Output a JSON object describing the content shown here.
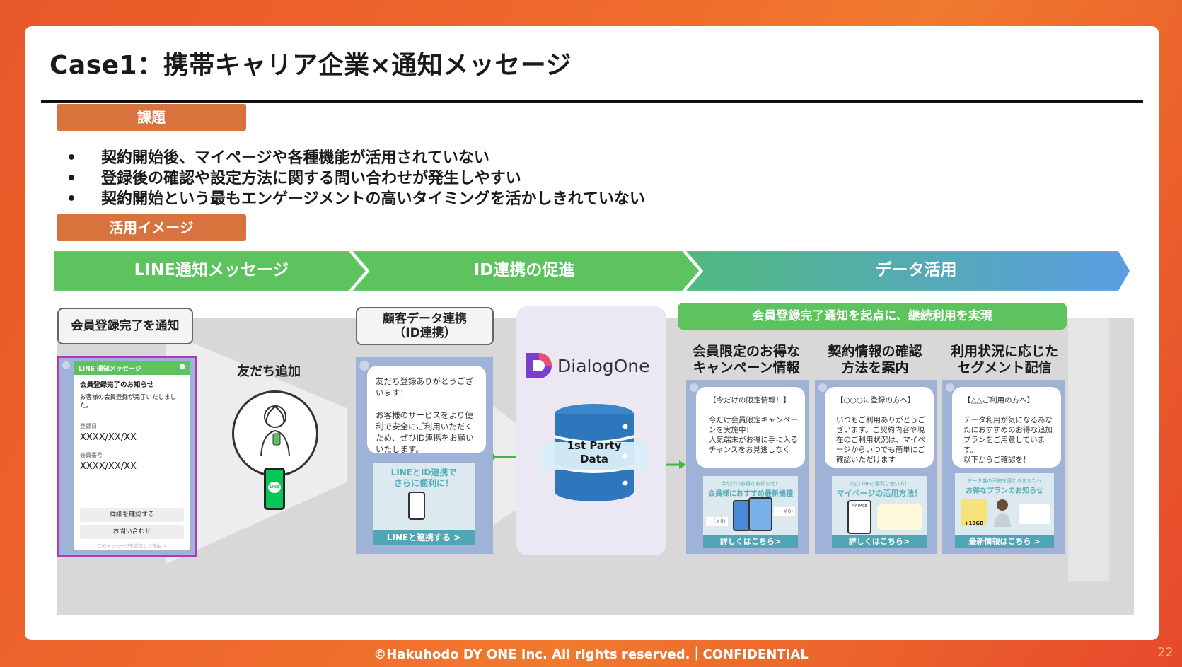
{
  "title": "Case1：携帯キャリア企業×通知メッセージ",
  "issue_label": "課題",
  "issues": [
    "契約開始後、マイページや各種機能が活用されていない",
    "登録後の確認や設定方法に関する問い合わせが発生しやすい",
    "契約開始という最もエンゲージメントの高いタイミングを活かしきれていない"
  ],
  "usage_label": "活用イメージ",
  "steps": [
    "LINE通知メッセージ",
    "ID連携の促進",
    "データ活用"
  ],
  "step1": {
    "box": "会員登録完了を通知",
    "header": "LINE 通知メッセージ",
    "msg_title": "会員登録完了のお知らせ",
    "msg_body": "お客様の会員登録が完了いたしました。",
    "field1_label": "登録日",
    "field1_value": "XXXX/XX/XX",
    "field2_label": "会員番号",
    "field2_value": "XXXX/XX/XX",
    "btn1": "詳細を確認する",
    "btn2": "お問い合わせ",
    "footer_note": "このメッセージを受信した理由 >",
    "friend_label": "友だち追加",
    "line_logo": "LINE"
  },
  "step2": {
    "box_line1": "顧客データ連携",
    "box_line2": "（ID連携）",
    "bubble": "友だち登録ありがとうございます！\n\nお客様のサービスをより便利で安全にご利用いただくため、ぜひID連携をお願いいたします。",
    "cta_title": "LINEとID連携で\nさらに便利に！",
    "cta_btn": "LINEと連携する >",
    "brand": "DialogOne",
    "db_label": "1st Party\nData"
  },
  "step3": {
    "banner": "会員登録完了通知を起点に、継続利用を実現",
    "cols": [
      {
        "head": "会員限定のお得な\nキャンペーン情報",
        "bubble": "【今だけの限定情報！】\n\n今だけ会員限定キャンペーンを実施中！\n人気端末がお得に手に入るチャンスをお見逃しなく",
        "cta_sub": "今だけのお得なお知らせ！",
        "cta_title": "会員様におすすめ最新機種",
        "tag1": "---(￥0)",
        "tag2": "---(￥0)",
        "btn": "詳しくはこちら>"
      },
      {
        "head": "契約情報の確認\n方法を案内",
        "bubble": "【○○○に登録の方へ】\n\nいつもご利用ありがとうございます。ご契約内容や現在のご利用状況は、マイページからいつでも簡単にご確認いただけます",
        "cta_sub": "公式LINEの便利な使い方！",
        "cta_title": "マイページの活用方法！",
        "phone_label": "MY PAGE",
        "btn": "詳しくはこちら>"
      },
      {
        "head": "利用状況に応じた\nセグメント配信",
        "bubble": "【△△ご利用の方へ】\n\nデータ利用が気になるあなたにおすすめのお得な追加プランをご用意しています。\n以下からご確認を！",
        "cta_sub": "データ量の不安を感じるあなたへ",
        "cta_title": "お得なプランのお知らせ",
        "tag": "+10GB",
        "btn": "最新情報はこちら >"
      }
    ]
  },
  "footer": "©Hakuhodo DY ONE Inc. All rights reserved.｜CONFIDENTIAL",
  "page_number": "22",
  "colors": {
    "accent": "#d9733d",
    "green": "#5cc35e",
    "blue": "#5b9be0",
    "line_green": "#06c755",
    "purple": "#b23ab8"
  }
}
